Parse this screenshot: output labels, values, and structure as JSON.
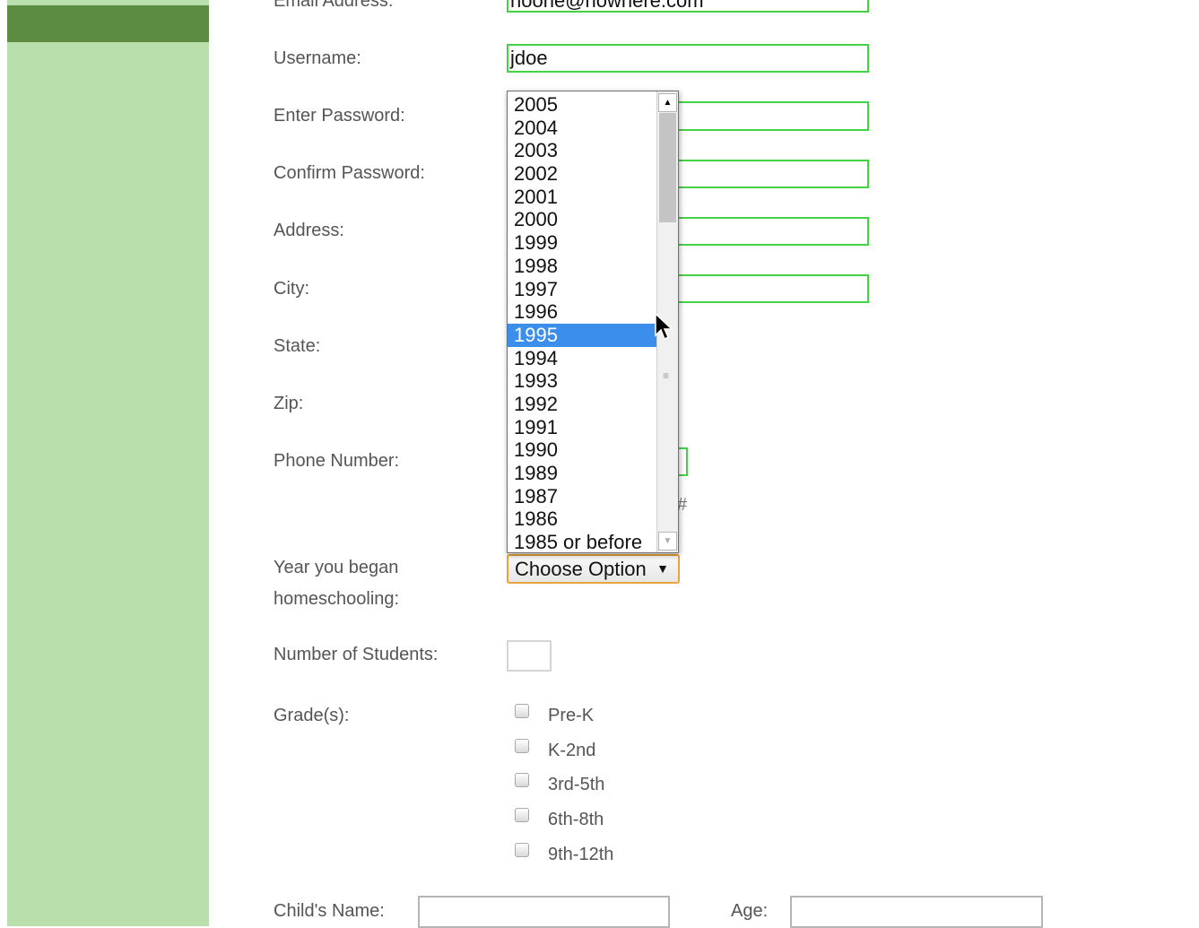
{
  "form": {
    "email": {
      "label": "Email Address:",
      "value": "noone@nowhere.com"
    },
    "username": {
      "label": "Username:",
      "value": "jdoe"
    },
    "password": {
      "label": "Enter Password:"
    },
    "confirm_password": {
      "label": "Confirm Password:"
    },
    "address": {
      "label": "Address:"
    },
    "city": {
      "label": "City:"
    },
    "state": {
      "label": "State:"
    },
    "zip": {
      "label": "Zip:"
    },
    "phone": {
      "label": "Phone Number:",
      "hint": "#"
    },
    "year_began": {
      "label_line1": "Year you began",
      "label_line2": "homeschooling:",
      "selected": "Choose Option",
      "arrow": "▼",
      "highlighted": "1995",
      "options": [
        "2005",
        "2004",
        "2003",
        "2002",
        "2001",
        "2000",
        "1999",
        "1998",
        "1997",
        "1996",
        "1995",
        "1994",
        "1993",
        "1992",
        "1991",
        "1990",
        "1989",
        "1987",
        "1986",
        "1985 or before"
      ]
    },
    "num_students": {
      "label": "Number of Students:"
    },
    "grades": {
      "label": "Grade(s):",
      "options": [
        "Pre-K",
        "K-2nd",
        "3rd-5th",
        "6th-8th",
        "9th-12th"
      ]
    },
    "child": {
      "name_label": "Child's Name:",
      "age_label": "Age:"
    }
  },
  "colors": {
    "sidebar": "#b8dfac",
    "sidebar_header": "#5b8c42",
    "field_border": "#45d145",
    "select_focus": "#e8a33a",
    "highlight": "#3b8eea"
  },
  "icons": {
    "scroll_up": "scroll-up-arrow-icon",
    "scroll_down": "scroll-down-arrow-icon",
    "cursor": "mouse-pointer-icon"
  }
}
